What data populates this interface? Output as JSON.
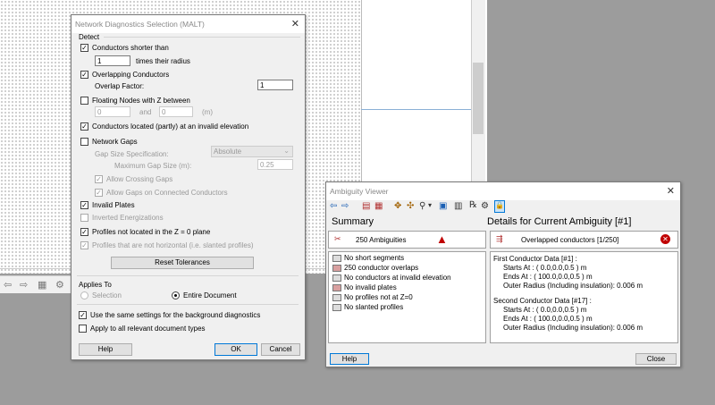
{
  "background_toolbar": {
    "icons": [
      "undo-icon",
      "redo-icon",
      "grid-icon",
      "tool-icon"
    ]
  },
  "diag": {
    "title": "Network Diagnostics Selection (MALT)",
    "detect_label": "Detect",
    "conductors_shorter_label": "Conductors shorter than",
    "radius_factor_value": "1",
    "times_radius_label": "times their radius",
    "overlapping_label": "Overlapping Conductors",
    "overlap_factor_label": "Overlap Factor:",
    "overlap_factor_value": "1",
    "floating_label": "Floating Nodes with Z between",
    "float_min": "0",
    "and_label": "and",
    "float_max": "0",
    "unit_m": "(m)",
    "invalid_elev_label": "Conductors located (partly) at an invalid elevation",
    "network_gaps_label": "Network Gaps",
    "gap_spec_label": "Gap Size Specification:",
    "gap_spec_value": "Absolute",
    "max_gap_label": "Maximum Gap Size (m):",
    "max_gap_value": "0.25",
    "allow_crossing_label": "Allow Crossing Gaps",
    "allow_connected_label": "Allow Gaps on Connected Conductors",
    "invalid_plates_label": "Invalid Plates",
    "inverted_label": "Inverted Energizations",
    "profiles_z0_label": "Profiles not located in the Z = 0 plane",
    "profiles_slanted_label": "Profiles that are not horizontal (i.e. slanted profiles)",
    "reset_label": "Reset Tolerances",
    "applies_to_label": "Applies To",
    "selection_label": "Selection",
    "entire_doc_label": "Entire Document",
    "use_same_label": "Use the same settings for the background diagnostics",
    "apply_all_label": "Apply to all relevant document types",
    "help_label": "Help",
    "ok_label": "OK",
    "cancel_label": "Cancel"
  },
  "amb": {
    "title": "Ambiguity Viewer",
    "summary_header": "Summary",
    "details_header": "Details for Current Ambiguity [#1]",
    "ambiguities_count": "250 Ambiguities",
    "current_label": "Overlapped conductors [1/250]",
    "summary_items": [
      "No short segments",
      "250 conductor overlaps",
      "No conductors at invalid elevation",
      "No invalid plates",
      "No profiles not at Z=0",
      "No slanted profiles"
    ],
    "details_lines": [
      "First Conductor Data [#1] :",
      "Starts At : ( 0.0,0.0,0.5 ) m",
      "Ends At : ( 100.0,0.0,0.5 ) m",
      "Outer Radius (Including insulation): 0.006 m",
      "",
      "Second Conductor Data [#17] :",
      "Starts At : ( 0.0,0.0,0.5 ) m",
      "Ends At : ( 100.0,0.0,0.5 ) m",
      "Outer Radius (Including insulation): 0.006 m"
    ],
    "help_label": "Help",
    "close_label": "Close"
  }
}
